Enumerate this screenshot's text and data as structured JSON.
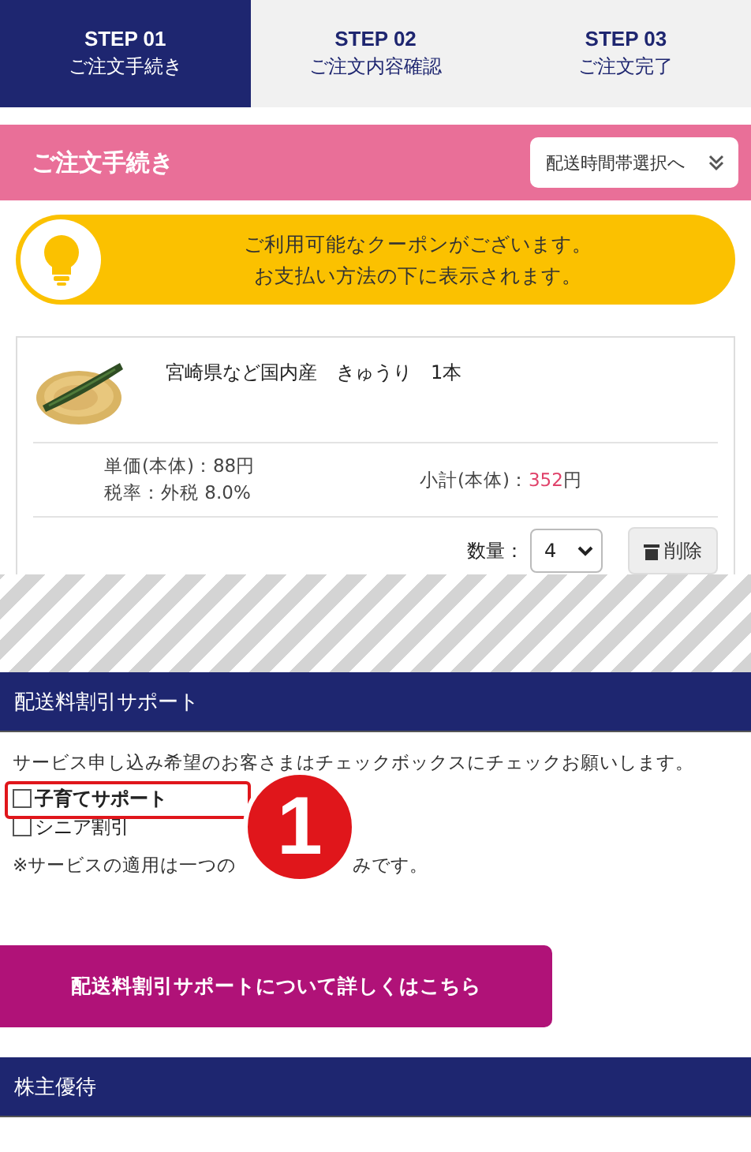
{
  "steps": [
    {
      "step": "STEP 01",
      "label": "ご注文手続き",
      "selected": true
    },
    {
      "step": "STEP 02",
      "label": "ご注文内容確認",
      "selected": false
    },
    {
      "step": "STEP 03",
      "label": "ご注文完了",
      "selected": false
    }
  ],
  "section_bar": {
    "title": "ご注文手続き",
    "jump_button": "配送時間帯選択へ"
  },
  "coupon_notice": {
    "lines": [
      "ご利用可能なクーポンがございます。",
      "お支払い方法の下に表示されます。"
    ]
  },
  "cart_item": {
    "name": "宮崎県など国内産　きゅうり　1本",
    "unit_price": "単価(本体)：88円",
    "tax_rate": "税率：外税 8.0%",
    "subtotal_label": "小計(本体)：",
    "subtotal_value": "352",
    "subtotal_unit": "円",
    "quantity_label": "数量：",
    "quantity": "4",
    "delete_button": "削除"
  },
  "shipping_support": {
    "title": "配送料割引サポート",
    "instruction": "サービス申し込み希望のお客さまはチェックボックスにチェックお願いします。",
    "options": [
      {
        "label": "子育てサポート",
        "checked": false,
        "highlighted": true
      },
      {
        "label": "シニア割引",
        "checked": false,
        "highlighted": false
      }
    ],
    "note_start": "※サービスの適用は一つの",
    "note_end": "みです。",
    "callout_number": "1",
    "details_button": "配送料割引サポートについて詳しくはこちら"
  },
  "shareholder": {
    "title": "株主優待"
  }
}
